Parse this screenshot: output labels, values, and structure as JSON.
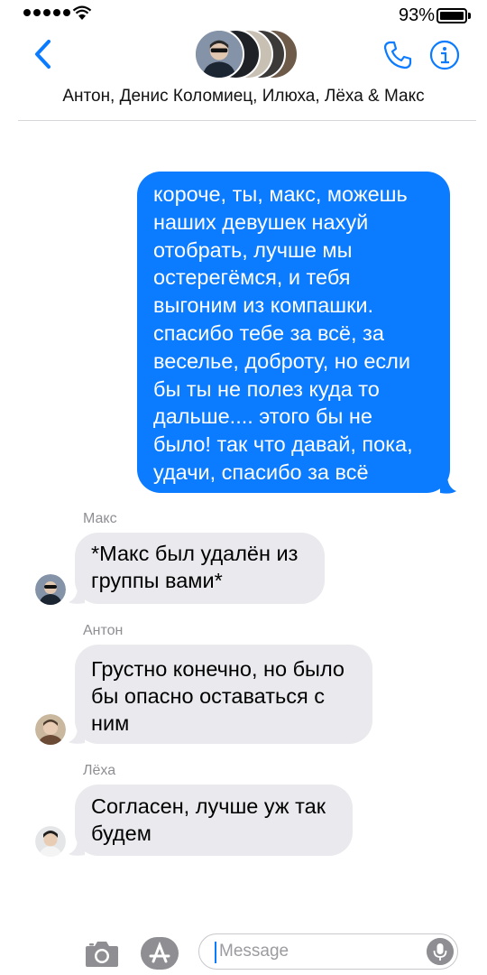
{
  "status_bar": {
    "battery_text": "93%"
  },
  "header": {
    "participants": "Антон, Денис Коломиец, Илюха, Лёха & Макс",
    "accent_color": "#0b7bff"
  },
  "messages": {
    "outgoing": {
      "lines": [
        "короче,  ты, макс,  можешь",
        "наших девушек нахуй",
        "отобрать, лучше мы",
        "остерегёмся,  и тебя",
        "выгоним из компашки.",
        "спасибо тебе за всё, за",
        "веселье, доброту, но если",
        "бы ты не полез куда то",
        "дальше.... этого бы не",
        "было! так что давай, пока,",
        "удачи, спасибо за всё"
      ]
    },
    "incoming": [
      {
        "sender": "Макс",
        "lines": [
          "*Макс был удалён из",
          "группы вами*"
        ]
      },
      {
        "sender": "Антон",
        "lines": [
          "Грустно конечно, но было",
          "бы опасно оставаться с",
          "ним"
        ]
      },
      {
        "sender": "Лёха",
        "lines": [
          "Согласен, лучше уж так",
          "будем"
        ]
      }
    ]
  },
  "composer": {
    "placeholder": "Message",
    "value": ""
  },
  "icons": [
    "back-chevron-icon",
    "group-avatars",
    "phone-icon",
    "info-icon",
    "camera-icon",
    "app-store-icon",
    "microphone-icon"
  ]
}
